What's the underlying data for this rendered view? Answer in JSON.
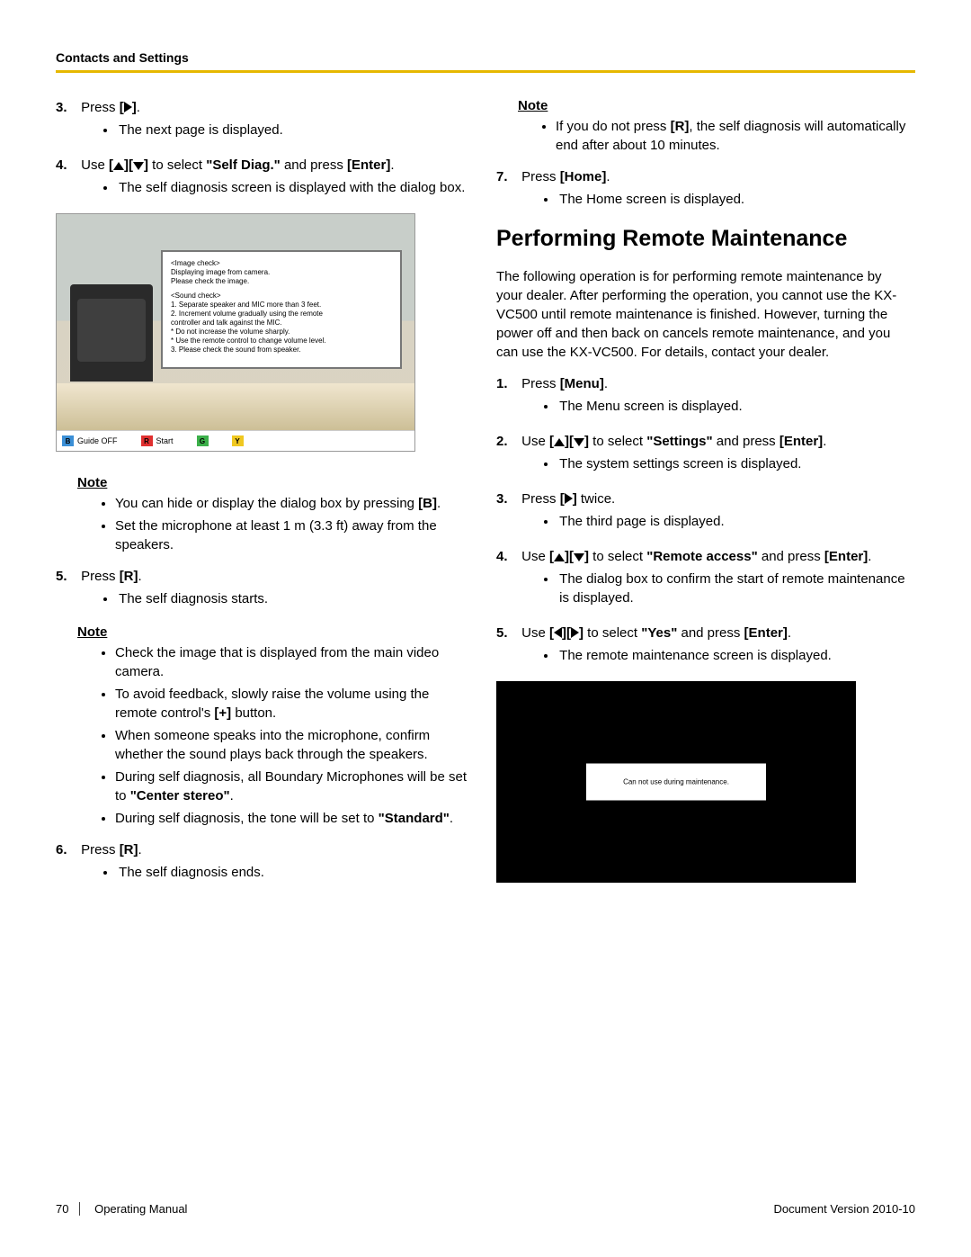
{
  "header": {
    "section_title": "Contacts and Settings"
  },
  "left": {
    "steps": [
      {
        "n": "3.",
        "text_pre": "Press ",
        "btn": "[",
        "icon": "right",
        "btn2": "]",
        "text_post": ".",
        "sub": [
          "The next page is displayed."
        ]
      },
      {
        "n": "4.",
        "text_pre": "Use ",
        "btn": "[",
        "icon": "up",
        "btn_mid": "][",
        "icon2": "down",
        "btn2": "]",
        "text_mid": " to select ",
        "bold1": "\"Self Diag.\"",
        "text_mid2": " and press ",
        "bold2": "[Enter]",
        "text_post": ".",
        "sub": [
          "The self diagnosis screen is displayed with the dialog box."
        ]
      },
      {
        "n": "5.",
        "text_pre": "Press ",
        "bold1": "[R]",
        "text_post": ".",
        "sub": [
          "The self diagnosis starts."
        ]
      },
      {
        "n": "6.",
        "text_pre": "Press ",
        "bold1": "[R]",
        "text_post": ".",
        "sub": [
          "The self diagnosis ends."
        ]
      }
    ],
    "note1": {
      "label": "Note",
      "items": [
        {
          "parts": [
            {
              "t": "You can hide or display the dialog box by pressing "
            },
            {
              "b": "[B]"
            },
            {
              "t": "."
            }
          ]
        },
        {
          "parts": [
            {
              "t": "Set the microphone at least 1 m (3.3 ft) away from the speakers."
            }
          ]
        }
      ]
    },
    "note2": {
      "label": "Note",
      "items": [
        {
          "parts": [
            {
              "t": "Check the image that is displayed from the main video camera."
            }
          ]
        },
        {
          "parts": [
            {
              "t": "To avoid feedback, slowly raise the volume using the remote control's "
            },
            {
              "b": "[+]"
            },
            {
              "t": " button."
            }
          ]
        },
        {
          "parts": [
            {
              "t": "When someone speaks into the microphone, confirm whether the sound plays back through the speakers."
            }
          ]
        },
        {
          "parts": [
            {
              "t": "During self diagnosis, all Boundary Microphones will be set to "
            },
            {
              "b": "\"Center stereo\""
            },
            {
              "t": "."
            }
          ]
        },
        {
          "parts": [
            {
              "t": "During self diagnosis, the tone will be set to "
            },
            {
              "b": "\"Standard\""
            },
            {
              "t": "."
            }
          ]
        }
      ]
    },
    "dialog": {
      "img_title": "<Image check>",
      "img_l1": "Displaying image from camera.",
      "img_l2": "Please check the image.",
      "snd_title": "<Sound check>",
      "snd_1": "1. Separate speaker and MIC more than 3 feet.",
      "snd_2": "2. Increment volume gradually using the remote",
      "snd_2b": "   controller and talk against the MIC.",
      "snd_2c": "   * Do not increase the volume sharply.",
      "snd_2d": "   * Use the remote control to change volume level.",
      "snd_3": "3. Please check the sound from speaker."
    },
    "bar": {
      "b": "B",
      "b_label": "Guide OFF",
      "r": "R",
      "r_label": "Start",
      "g": "G",
      "y": "Y"
    }
  },
  "right": {
    "top_note": {
      "label": "Note",
      "items": [
        {
          "parts": [
            {
              "t": "If you do not press "
            },
            {
              "b": "[R]"
            },
            {
              "t": ", the self diagnosis will automatically end after about 10 minutes."
            }
          ]
        }
      ]
    },
    "step7": {
      "n": "7.",
      "text_pre": "Press ",
      "bold1": "[Home]",
      "text_post": ".",
      "sub": [
        "The Home screen is displayed."
      ]
    },
    "heading": "Performing Remote Maintenance",
    "intro": "The following operation is for performing remote maintenance by your dealer. After performing the operation, you cannot use the KX-VC500 until remote maintenance is finished. However, turning the power off and then back on cancels remote maintenance, and you can use the KX-VC500. For details, contact your dealer.",
    "steps": [
      {
        "n": "1.",
        "text_pre": "Press ",
        "bold1": "[Menu]",
        "text_post": ".",
        "sub": [
          "The Menu screen is displayed."
        ]
      },
      {
        "n": "2.",
        "text_pre": "Use ",
        "btn": "[",
        "icon": "up",
        "btn_mid": "][",
        "icon2": "down",
        "btn2": "]",
        "text_mid": " to select ",
        "bold1": "\"Settings\"",
        "text_mid2": " and press ",
        "bold2": "[Enter]",
        "text_post": ".",
        "sub": [
          "The system settings screen is displayed."
        ]
      },
      {
        "n": "3.",
        "text_pre": "Press ",
        "btn": "[",
        "icon": "right",
        "btn2": "]",
        "text_post": " twice.",
        "sub": [
          "The third page is displayed."
        ]
      },
      {
        "n": "4.",
        "text_pre": "Use ",
        "btn": "[",
        "icon": "up",
        "btn_mid": "][",
        "icon2": "down",
        "btn2": "]",
        "text_mid": " to select ",
        "bold1": "\"Remote access\"",
        "text_mid2": " and press ",
        "bold2": "[Enter]",
        "text_post": ".",
        "sub": [
          "The dialog box to confirm the start of remote maintenance is displayed."
        ]
      },
      {
        "n": "5.",
        "text_pre": "Use ",
        "btn": "[",
        "icon": "left",
        "btn_mid": "][",
        "icon2": "right",
        "btn2": "]",
        "text_mid": " to select ",
        "bold1": "\"Yes\"",
        "text_mid2": " and press ",
        "bold2": "[Enter]",
        "text_post": ".",
        "sub": [
          "The remote maintenance screen is displayed."
        ]
      }
    ],
    "dialog2": "Can not use during maintenance."
  },
  "footer": {
    "page": "70",
    "manual": "Operating Manual",
    "version": "Document Version  2010-10"
  }
}
